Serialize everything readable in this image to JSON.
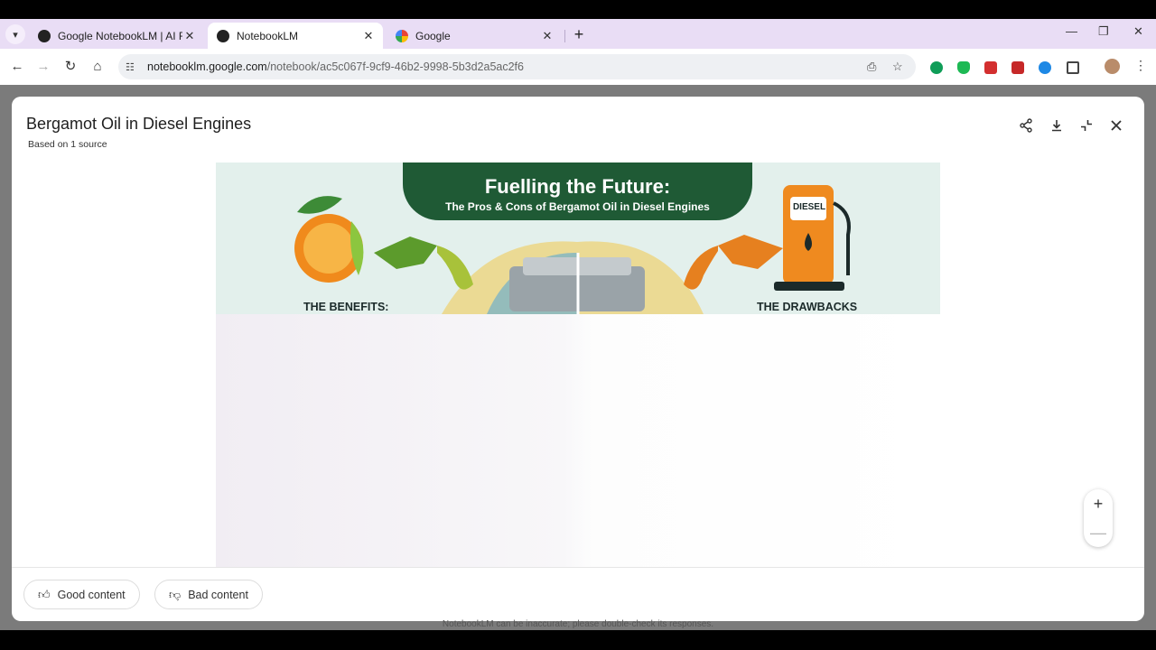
{
  "browser": {
    "tabs": [
      {
        "title": "Google NotebookLM | AI Resea",
        "favicon": "notebooklm-icon"
      },
      {
        "title": "NotebookLM",
        "favicon": "notebooklm-icon"
      },
      {
        "title": "Google",
        "favicon": "google-icon"
      }
    ],
    "url_domain": "notebooklm.google.com",
    "url_path": "/notebook/ac5c067f-9cf9-46b2-9998-5b3d2a5ac2f6"
  },
  "dialog": {
    "title": "Bergamot Oil in Diesel Engines",
    "subtitle": "Based on 1 source",
    "actions": [
      "share-icon",
      "download-icon",
      "collapse-icon",
      "close-icon"
    ]
  },
  "infographic": {
    "title": "Fuelling the Future:",
    "subtitle": "The Pros & Cons of Bergamot Oil in Diesel Engines",
    "left_label": "THE BENEFITS:",
    "right_label": "THE DRAWBACKS",
    "pump_label": "DIESEL"
  },
  "feedback": {
    "good_label": "Good content",
    "bad_label": "Bad content"
  },
  "disclaimer": "NotebookLM can be inaccurate; please double-check its responses.",
  "colors": {
    "tabbar": "#e9ddf5",
    "banner": "#1f5a35",
    "dialog_bg": "#ffffff"
  }
}
